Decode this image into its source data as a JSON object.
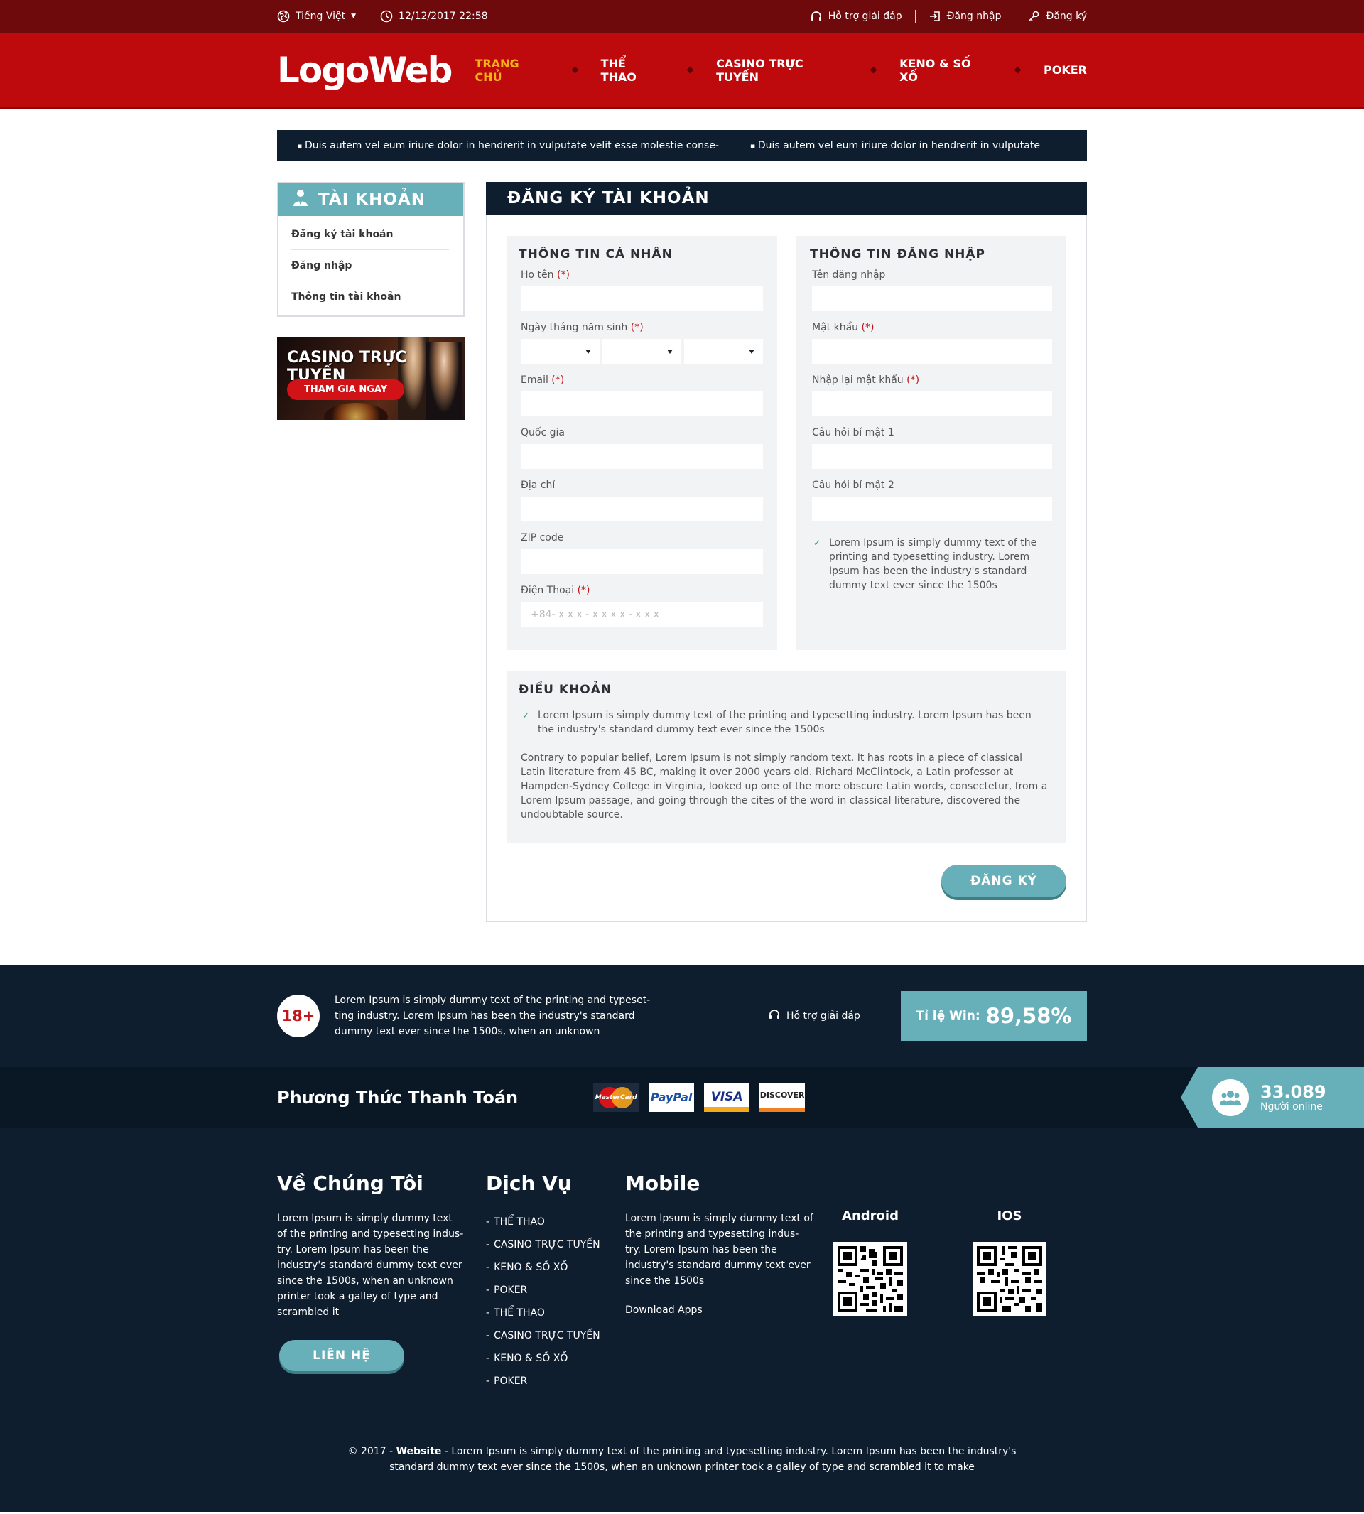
{
  "topbar": {
    "language": "Tiếng Việt",
    "datetime": "12/12/2017 22:58",
    "support": "Hỗ trợ giải đáp",
    "login": "Đăng nhập",
    "register": "Đăng ký"
  },
  "header": {
    "logo": "LogoWeb",
    "nav": [
      "TRANG CHỦ",
      "THỂ THAO",
      "CASINO TRỰC TUYẾN",
      "KENO & SỐ XỐ",
      "POKER"
    ]
  },
  "marquee": [
    "Duis autem vel eum iriure dolor in hendrerit in vulputate velit esse molestie conse-",
    "Duis autem vel eum iriure dolor in hendrerit in vulputate"
  ],
  "sidebar": {
    "title": "TÀI KHOẢN",
    "items": [
      "Đăng ký tài khoản",
      "Đăng nhập",
      "Thông tin tài khoản"
    ],
    "banner_title": "CASINO TRỰC TUYẾN",
    "banner_button": "THAM GIA NGAY"
  },
  "form": {
    "title": "ĐĂNG KÝ TÀI KHOẢN",
    "personal": {
      "title": "THÔNG TIN CÁ NHÂN",
      "fullname": "Họ tên",
      "birthday": "Ngày tháng năm sinh",
      "email": "Email",
      "country": "Quốc gia",
      "address": "Địa chỉ",
      "zip": "ZIP code",
      "phone": "Điện Thoại",
      "phone_placeholder": "+84- x x x - x x x x - x x x"
    },
    "login": {
      "title": "THÔNG TIN ĐĂNG NHẬP",
      "username": "Tên đăng nhập",
      "password": "Mật khẩu",
      "password_confirm": "Nhập lại mật khẩu",
      "question1": "Câu hỏi bí mật 1",
      "question2": "Câu hỏi bí mật 2",
      "agree_text": "Lorem Ipsum is simply dummy text of the printing and typesetting industry. Lorem Ipsum has been the industry's standard dummy text ever since the 1500s"
    },
    "required_mark": "(*)",
    "terms": {
      "title": "ĐIỀU KHOẢN",
      "check_text": "Lorem Ipsum is simply dummy text of the printing and typesetting industry. Lorem Ipsum has been the industry's standard dummy text ever since the 1500s",
      "body": "Contrary to popular belief, Lorem Ipsum is not simply random text. It has roots in a piece of classical Latin literature from 45 BC, making it over 2000 years old. Richard McClintock, a Latin professor at Hampden-Sydney College in Virginia, looked up one of the more obscure Latin words, consectetur, from a Lorem Ipsum passage, and going through the cites of the word in classical literature, discovered the undoubtable source."
    },
    "submit": "ĐĂNG KÝ"
  },
  "footer_strip": {
    "age": "18+",
    "text": "Lorem Ipsum is simply dummy text of the printing and typeset-ting industry. Lorem Ipsum has been the industry's standard dummy text ever since the 1500s, when an unknown",
    "support": "Hỗ trợ giải đáp",
    "win_label": "Tỉ lệ Win:",
    "win_value": "89,58%"
  },
  "payment": {
    "title": "Phương Thức Thanh Toán",
    "cards": [
      "MasterCard",
      "PayPal",
      "VISA",
      "DISCOVER"
    ],
    "online_count": "33.089",
    "online_label": "Người online"
  },
  "footer": {
    "about_title": "Về Chúng Tôi",
    "about_text": "Lorem Ipsum is simply dummy text of the printing and typesetting indus-try. Lorem Ipsum has been the industry's standard dummy text ever since the 1500s, when an unknown printer took a galley of type and scrambled it",
    "contact": "LIÊN HỆ",
    "service_title": "Dịch Vụ",
    "services": [
      "THỂ THAO",
      "CASINO TRỰC TUYẾN",
      "KENO & SỐ XỐ",
      "POKER",
      "THỂ THAO",
      "CASINO TRỰC TUYẾN",
      "KENO & SỐ XỐ",
      "POKER"
    ],
    "mobile_title": "Mobile",
    "mobile_text": "Lorem Ipsum is simply dummy text of the printing and typesetting indus-try. Lorem Ipsum has been the industry's standard dummy text ever since the 1500s",
    "download": "Download Apps",
    "android": "Android",
    "ios": "IOS"
  },
  "copyright": {
    "prefix": "© 2017 - ",
    "site": "Website",
    "text": " - Lorem Ipsum is simply dummy text of the printing and typesetting industry. Lorem Ipsum has been the industry's",
    "line2": "standard dummy text ever since the 1500s, when an unknown printer took a galley of type and scrambled it to make"
  },
  "colors": {
    "topbar": "#6f0a0c",
    "header": "#bf0a0d",
    "nav_active": "#f7b315",
    "navy": "#0f1e2e",
    "teal": "#67b0b9",
    "required": "#c0171c"
  }
}
